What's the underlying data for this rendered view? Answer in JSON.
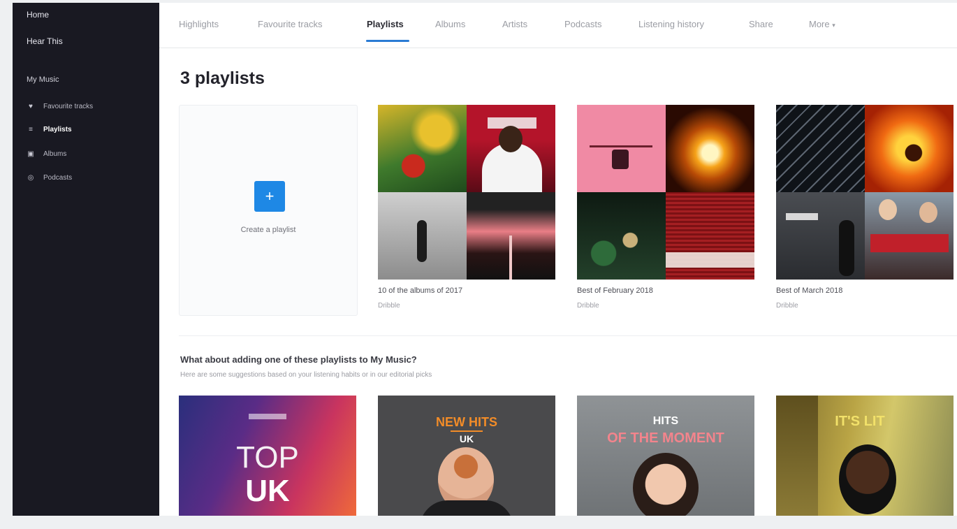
{
  "sidebar": {
    "home": "Home",
    "hear_this": "Hear This",
    "section": "My Music",
    "items": [
      {
        "label": "Favourite tracks",
        "icon": "heart-icon"
      },
      {
        "label": "Playlists",
        "icon": "playlist-icon"
      },
      {
        "label": "Albums",
        "icon": "album-icon"
      },
      {
        "label": "Podcasts",
        "icon": "podcast-icon"
      }
    ]
  },
  "tabs": [
    {
      "label": "Highlights"
    },
    {
      "label": "Favourite tracks"
    },
    {
      "label": "Playlists"
    },
    {
      "label": "Albums"
    },
    {
      "label": "Artists"
    },
    {
      "label": "Podcasts"
    },
    {
      "label": "Listening history"
    },
    {
      "label": "Share"
    },
    {
      "label": "More"
    }
  ],
  "active_tab": "Playlists",
  "page_title": "3 playlists",
  "create_playlist": {
    "label": "Create a playlist"
  },
  "playlists": [
    {
      "title": "10 of the albums of 2017",
      "sub": "Dribble"
    },
    {
      "title": "Best of February 2018",
      "sub": "Dribble"
    },
    {
      "title": "Best of March 2018",
      "sub": "Dribble"
    }
  ],
  "suggestions": {
    "title": "What about adding one of these playlists to My Music?",
    "subtitle": "Here are some suggestions based on your listening habits or in our editorial picks",
    "cards": [
      {
        "line1": "TOP",
        "line2": "UK",
        "logo": "deezer"
      },
      {
        "line1": "NEW HITS",
        "line2": "UK"
      },
      {
        "line1": "HITS",
        "line2": "OF THE MOMENT"
      },
      {
        "line1": "IT'S LIT",
        "line2": ""
      }
    ]
  },
  "colors": {
    "sidebar_bg": "#191922",
    "accent": "#2a7bd4",
    "create_button": "#1e88e5"
  }
}
